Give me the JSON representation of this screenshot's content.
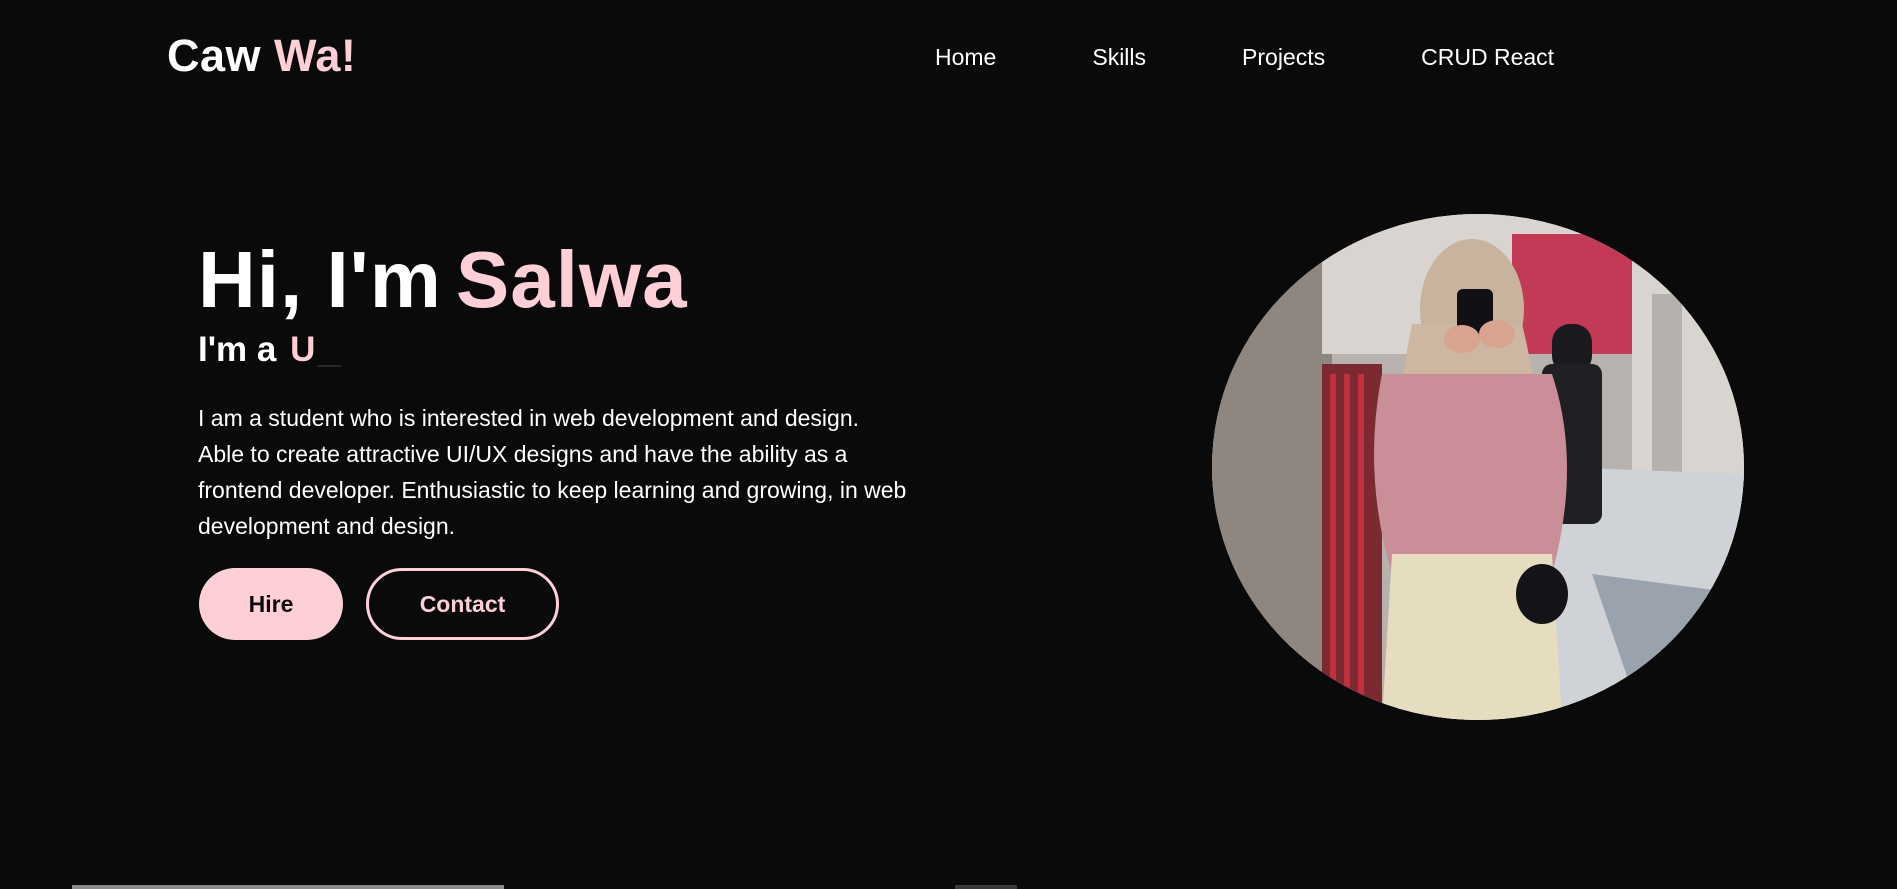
{
  "header": {
    "logo_main": "Caw",
    "logo_accent": "Wa!"
  },
  "nav": {
    "items": [
      {
        "label": "Home"
      },
      {
        "label": "Skills"
      },
      {
        "label": "Projects"
      },
      {
        "label": "CRUD React"
      }
    ]
  },
  "hero": {
    "greeting": "Hi, I'm",
    "name": "Salwa",
    "subtitle_prefix": "I'm a",
    "subtitle_typed": "U",
    "description": "I am a student who is interested in web development and design. Able to create attractive UI/UX designs and have the ability as a frontend developer. Enthusiastic to keep learning and growing, in web development and design.",
    "hire_label": "Hire",
    "contact_label": "Contact"
  },
  "colors": {
    "background": "#0a0a0a",
    "accent": "#ffcfd8",
    "text": "#ffffff"
  }
}
